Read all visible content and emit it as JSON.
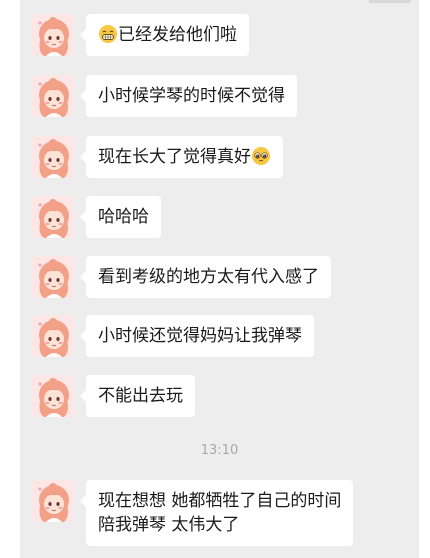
{
  "messages": [
    {
      "emoji_before": "grinning-face-emoji",
      "text": "已经发给他们啦"
    },
    {
      "text": "小时候学琴的时候不觉得"
    },
    {
      "text": "现在长大了觉得真好",
      "emoji_after": "pleading-face-emoji"
    },
    {
      "text": "哈哈哈"
    },
    {
      "text": "看到考级的地方太有代入感了"
    },
    {
      "text": "小时候还觉得妈妈让我弹琴"
    },
    {
      "text": "不能出去玩"
    },
    {
      "line1": "现在想想 她都牺牲了自己的时间",
      "line2": "陪我弹琴 太伟大了"
    }
  ],
  "timestamp": "13:10",
  "colors": {
    "chat_background": "#ededed",
    "bubble": "#ffffff",
    "text": "#1a1a1a",
    "timestamp": "#a8a8a8",
    "avatar_hair": "#f2a088"
  },
  "icons": {
    "avatar": "girl-avatar",
    "emoji_1": "grinning-face-emoji",
    "emoji_2": "pleading-face-emoji"
  }
}
